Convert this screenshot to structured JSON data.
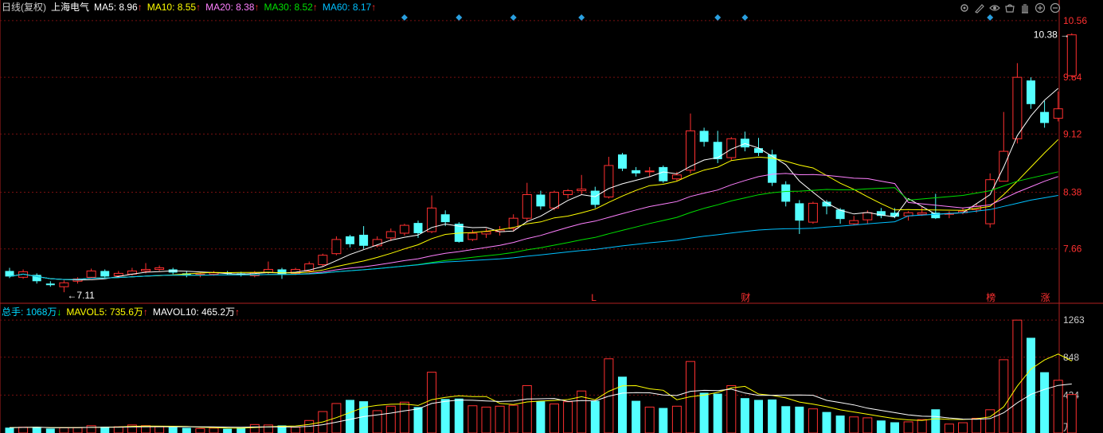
{
  "header": {
    "period": "日线(复权)",
    "stock": "上海电气",
    "ma": [
      {
        "label": "MA5: 8.96",
        "arrow": "↑",
        "color": "#ffffff"
      },
      {
        "label": "MA10: 8.55",
        "arrow": "↑",
        "color": "#ffff00"
      },
      {
        "label": "MA20: 8.38",
        "arrow": "↑",
        "color": "#ff80ff"
      },
      {
        "label": "MA30: 8.52",
        "arrow": "↑",
        "color": "#00e000"
      },
      {
        "label": "MA60: 8.17",
        "arrow": "↑",
        "color": "#00c0ff"
      }
    ]
  },
  "volume_header": {
    "items": [
      {
        "label": "总手: 1068万",
        "arrow": "↓",
        "color": "#00d8ff"
      },
      {
        "label": "MAVOL5: 735.6万",
        "arrow": "↑",
        "color": "#ffff00"
      },
      {
        "label": "MAVOL10: 465.2万",
        "arrow": "↑",
        "color": "#ffffff"
      }
    ]
  },
  "toolbar": {
    "icons": [
      "settings-icon",
      "draw-icon",
      "eye-icon",
      "basket-icon",
      "hand-icon",
      "zoom-in-icon",
      "zoom-out-icon"
    ]
  },
  "chart_data": {
    "type": "candlestick",
    "price_axis": {
      "ticks": [
        7.66,
        8.38,
        9.12,
        9.84,
        10.56
      ],
      "range": [
        6.98,
        10.62
      ]
    },
    "volume_axis": {
      "ticks": [
        424,
        848,
        1263
      ],
      "unit": "万",
      "range": [
        0,
        1300
      ]
    },
    "high_label": "10.38",
    "low_label": "7.11",
    "event_markers": [
      {
        "index": 43,
        "text": "L",
        "color": "#ff3030"
      },
      {
        "index": 54,
        "text": "财",
        "color": "#ff3030"
      },
      {
        "index": 72,
        "text": "榜",
        "color": "#ff3030"
      },
      {
        "index": 76,
        "text": "涨",
        "color": "#ff3030"
      }
    ],
    "diamond_indices": [
      29,
      33,
      37,
      42,
      52,
      54,
      72
    ],
    "candles": [
      [
        7.38,
        7.31,
        7.42,
        7.29,
        60
      ],
      [
        7.3,
        7.37,
        7.4,
        7.28,
        65
      ],
      [
        7.33,
        7.25,
        7.35,
        7.22,
        68
      ],
      [
        7.22,
        7.2,
        7.25,
        7.18,
        50
      ],
      [
        7.18,
        7.23,
        7.26,
        7.11,
        58
      ],
      [
        7.25,
        7.28,
        7.3,
        7.22,
        60
      ],
      [
        7.3,
        7.38,
        7.41,
        7.29,
        82
      ],
      [
        7.38,
        7.31,
        7.4,
        7.29,
        70
      ],
      [
        7.32,
        7.35,
        7.38,
        7.3,
        70
      ],
      [
        7.34,
        7.38,
        7.42,
        7.32,
        90
      ],
      [
        7.38,
        7.4,
        7.48,
        7.35,
        82
      ],
      [
        7.4,
        7.42,
        7.45,
        7.38,
        70
      ],
      [
        7.4,
        7.36,
        7.42,
        7.34,
        65
      ],
      [
        7.35,
        7.32,
        7.38,
        7.3,
        58
      ],
      [
        7.33,
        7.34,
        7.36,
        7.3,
        50
      ],
      [
        7.34,
        7.36,
        7.38,
        7.32,
        55
      ],
      [
        7.36,
        7.35,
        7.38,
        7.33,
        48
      ],
      [
        7.35,
        7.33,
        7.37,
        7.31,
        60
      ],
      [
        7.32,
        7.36,
        7.38,
        7.3,
        95
      ],
      [
        7.36,
        7.4,
        7.5,
        7.34,
        90
      ],
      [
        7.4,
        7.33,
        7.42,
        7.28,
        85
      ],
      [
        7.35,
        7.4,
        7.42,
        7.33,
        65
      ],
      [
        7.38,
        7.47,
        7.5,
        7.36,
        140
      ],
      [
        7.46,
        7.58,
        7.6,
        7.44,
        240
      ],
      [
        7.6,
        7.78,
        7.82,
        7.58,
        330
      ],
      [
        7.82,
        7.72,
        7.84,
        7.68,
        370
      ],
      [
        7.84,
        7.7,
        7.95,
        7.66,
        355
      ],
      [
        7.7,
        7.78,
        7.82,
        7.68,
        250
      ],
      [
        7.8,
        7.88,
        7.92,
        7.76,
        300
      ],
      [
        7.86,
        7.96,
        7.98,
        7.83,
        345
      ],
      [
        7.99,
        7.86,
        8.02,
        7.8,
        290
      ],
      [
        7.88,
        8.18,
        8.34,
        7.86,
        680
      ],
      [
        8.1,
        8.0,
        8.15,
        7.95,
        380
      ],
      [
        7.98,
        7.75,
        8.0,
        7.74,
        385
      ],
      [
        7.78,
        7.86,
        7.9,
        7.76,
        305
      ],
      [
        7.85,
        7.88,
        7.92,
        7.8,
        290
      ],
      [
        7.88,
        7.9,
        7.95,
        7.83,
        300
      ],
      [
        7.92,
        8.05,
        8.1,
        7.88,
        310
      ],
      [
        8.05,
        8.35,
        8.5,
        8.0,
        530
      ],
      [
        8.35,
        8.2,
        8.4,
        8.16,
        355
      ],
      [
        8.18,
        8.38,
        8.4,
        8.15,
        325
      ],
      [
        8.35,
        8.4,
        8.42,
        8.3,
        350
      ],
      [
        8.4,
        8.42,
        8.6,
        8.35,
        470
      ],
      [
        8.4,
        8.22,
        8.45,
        8.18,
        360
      ],
      [
        8.32,
        8.72,
        8.83,
        8.3,
        830
      ],
      [
        8.86,
        8.68,
        8.88,
        8.65,
        630
      ],
      [
        8.66,
        8.62,
        8.7,
        8.58,
        360
      ],
      [
        8.64,
        8.65,
        8.7,
        8.58,
        290
      ],
      [
        8.7,
        8.52,
        8.72,
        8.5,
        280
      ],
      [
        8.55,
        8.6,
        8.64,
        8.52,
        300
      ],
      [
        8.66,
        9.16,
        9.38,
        8.62,
        800
      ],
      [
        9.16,
        9.02,
        9.2,
        8.96,
        450
      ],
      [
        9.02,
        8.8,
        9.16,
        8.75,
        440
      ],
      [
        8.82,
        9.06,
        9.08,
        8.78,
        530
      ],
      [
        9.06,
        8.95,
        9.15,
        8.9,
        390
      ],
      [
        8.94,
        8.88,
        9.07,
        8.84,
        370
      ],
      [
        8.86,
        8.5,
        8.92,
        8.46,
        375
      ],
      [
        8.48,
        8.26,
        8.52,
        8.2,
        300
      ],
      [
        8.24,
        8.02,
        8.28,
        7.85,
        295
      ],
      [
        8.0,
        8.24,
        8.26,
        7.98,
        270
      ],
      [
        8.26,
        8.2,
        8.28,
        8.1,
        235
      ],
      [
        8.16,
        8.04,
        8.18,
        7.98,
        195
      ],
      [
        7.98,
        8.02,
        8.08,
        7.96,
        180
      ],
      [
        8.03,
        8.12,
        8.15,
        7.98,
        170
      ],
      [
        8.14,
        8.08,
        8.18,
        8.05,
        140
      ],
      [
        8.12,
        8.07,
        8.18,
        8.05,
        120
      ],
      [
        8.08,
        8.12,
        8.14,
        8.02,
        125
      ],
      [
        8.1,
        8.12,
        8.2,
        8.08,
        150
      ],
      [
        8.12,
        8.05,
        8.36,
        8.04,
        265
      ],
      [
        8.1,
        8.11,
        8.14,
        8.05,
        100
      ],
      [
        8.12,
        8.14,
        8.18,
        8.1,
        115
      ],
      [
        8.16,
        8.2,
        8.24,
        8.12,
        165
      ],
      [
        7.98,
        8.54,
        8.62,
        7.93,
        260
      ],
      [
        8.52,
        8.9,
        9.4,
        8.52,
        820
      ],
      [
        9.06,
        9.84,
        10.02,
        9.0,
        1263
      ],
      [
        9.8,
        9.5,
        9.84,
        9.44,
        1065
      ],
      [
        9.4,
        9.26,
        9.54,
        9.2,
        680
      ],
      [
        9.32,
        9.44,
        9.66,
        9.28,
        590
      ],
      [
        9.86,
        10.38,
        10.4,
        9.84,
        430
      ]
    ],
    "ma": [
      {
        "name": "MA5",
        "color": "#ffffff",
        "points": [
          [
            66,
            8.3
          ],
          [
            68,
            8.1
          ],
          [
            70,
            8.12
          ],
          [
            72,
            8.35
          ],
          [
            73,
            8.7
          ],
          [
            74,
            9.1
          ],
          [
            75,
            9.35
          ],
          [
            76,
            9.55
          ],
          [
            77,
            9.7
          ]
        ]
      },
      {
        "name": "MA10",
        "color": "#ffff00",
        "points": [
          [
            66,
            8.16
          ],
          [
            70,
            8.15
          ],
          [
            72,
            8.2
          ],
          [
            73,
            8.35
          ],
          [
            74,
            8.52
          ],
          [
            75,
            8.7
          ],
          [
            76,
            8.88
          ],
          [
            77,
            9.05
          ]
        ]
      },
      {
        "name": "MA20",
        "color": "#ff80ff",
        "points": [
          [
            66,
            8.25
          ],
          [
            70,
            8.18
          ],
          [
            72,
            8.22
          ],
          [
            73,
            8.3
          ],
          [
            74,
            8.38
          ],
          [
            75,
            8.45
          ],
          [
            76,
            8.52
          ],
          [
            77,
            8.58
          ]
        ]
      },
      {
        "name": "MA30",
        "color": "#00e000",
        "points": [
          [
            66,
            8.28
          ],
          [
            70,
            8.34
          ],
          [
            72,
            8.4
          ],
          [
            73,
            8.46
          ],
          [
            74,
            8.52
          ],
          [
            75,
            8.56
          ],
          [
            76,
            8.6
          ],
          [
            77,
            8.64
          ]
        ]
      },
      {
        "name": "MA60",
        "color": "#00c0ff",
        "points": [
          [
            66,
            8.08
          ],
          [
            70,
            8.12
          ],
          [
            72,
            8.16
          ],
          [
            73,
            8.2
          ],
          [
            74,
            8.24
          ],
          [
            75,
            8.28
          ],
          [
            76,
            8.31
          ],
          [
            77,
            8.34
          ]
        ]
      }
    ]
  }
}
